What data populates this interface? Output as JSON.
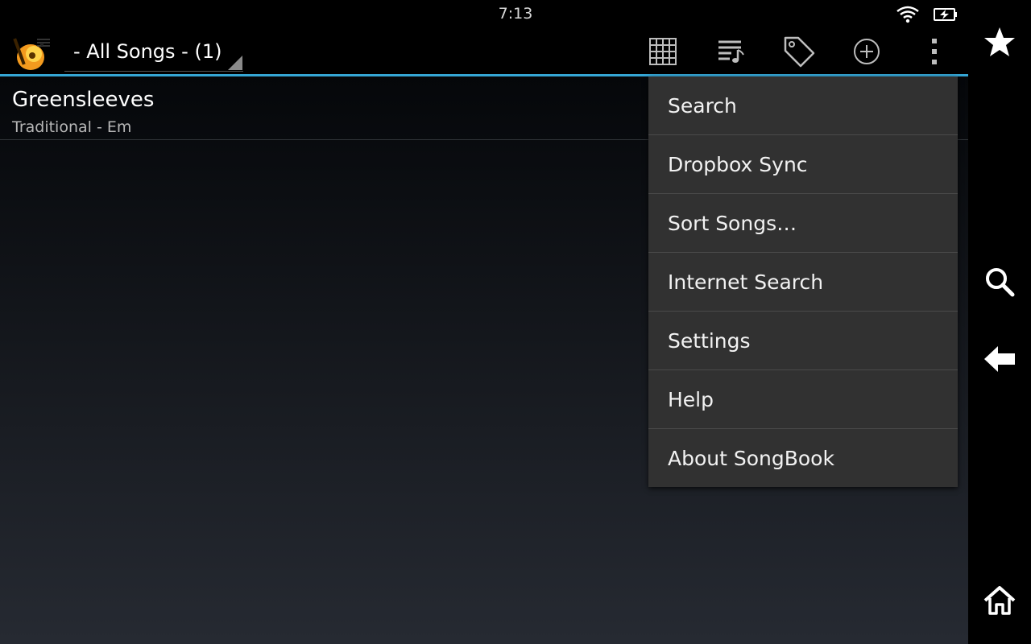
{
  "status_bar": {
    "time": "7:13",
    "icons": [
      "wifi-icon",
      "battery-charging-icon"
    ]
  },
  "action_bar": {
    "app_icon": "songbook-guitar-icon",
    "spinner_label": "- All Songs - (1)",
    "actions": [
      "chord-grid-icon",
      "setlist-icon",
      "tag-icon",
      "add-icon",
      "overflow-menu-icon"
    ]
  },
  "songs": [
    {
      "title": "Greensleeves",
      "subtitle": "Traditional - Em"
    }
  ],
  "overflow_menu": {
    "items": [
      "Search",
      "Dropbox Sync",
      "Sort Songs…",
      "Internet Search",
      "Settings",
      "Help",
      "About SongBook"
    ]
  },
  "nav_bar": {
    "buttons": [
      "star-icon",
      "search-icon",
      "back-icon",
      "home-icon"
    ]
  },
  "colors": {
    "accent": "#35a6d5",
    "menu_bg": "#313131"
  }
}
